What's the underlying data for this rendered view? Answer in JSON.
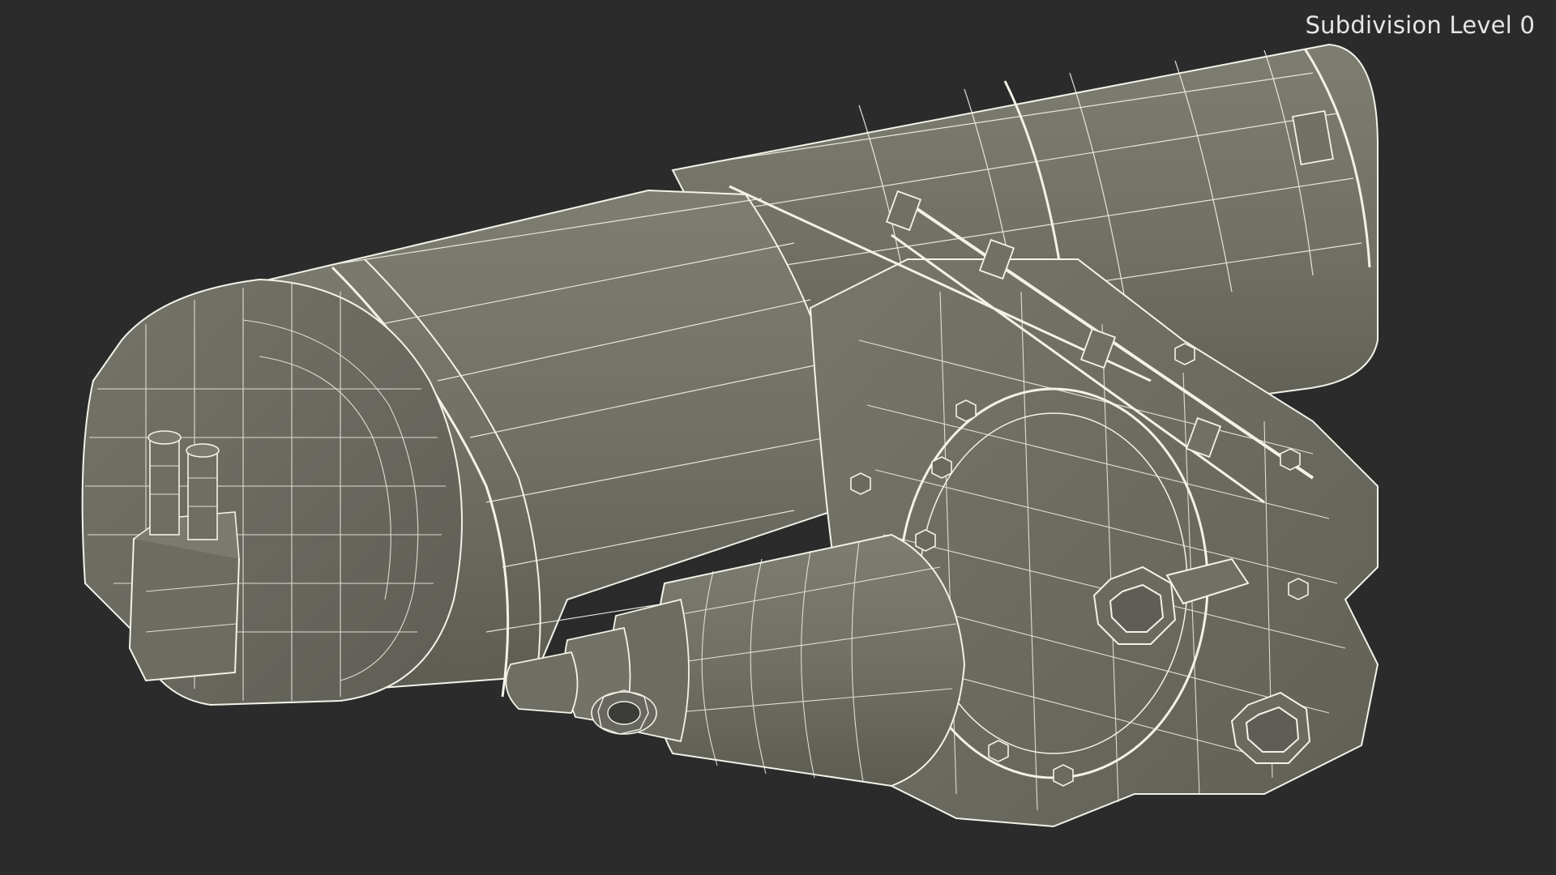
{
  "viewport": {
    "overlay_label": "Subdivision Level 0",
    "background_color": "#2b2b2b",
    "model_color": "#707065",
    "wire_color": "#f2f2e8"
  },
  "model": {
    "description_icon": "wireframe-mesh-icon"
  }
}
